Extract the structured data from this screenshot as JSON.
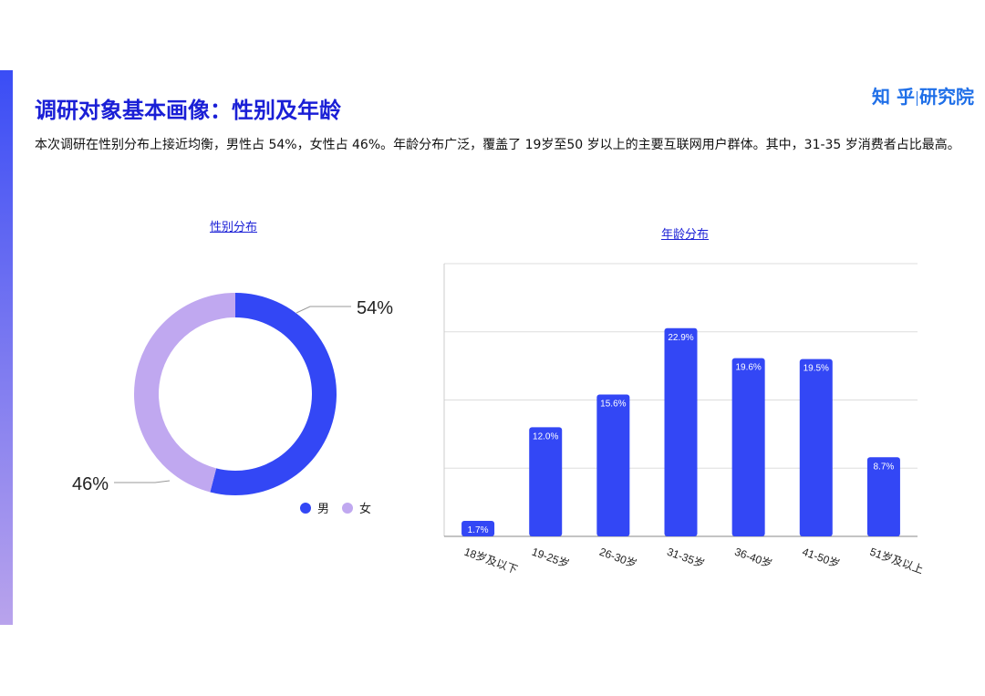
{
  "header": {
    "title": "调研对象基本画像：性别及年龄",
    "logo_left": "知 乎",
    "logo_right": "研究院",
    "description": "本次调研在性别分布上接近均衡，男性占 54%，女性占 46%。年龄分布广泛，覆盖了 19岁至50 岁以上的主要互联网用户群体。其中，31-35 岁消费者占比最高。"
  },
  "colors": {
    "accent": "#3347f5",
    "secondary": "#c0a8f0",
    "title": "#1a1fd6"
  },
  "chart_data": [
    {
      "type": "pie",
      "title": "性别分布",
      "categories": [
        "男",
        "女"
      ],
      "values": [
        54,
        46
      ],
      "labels": [
        "54%",
        "46%"
      ],
      "colors": [
        "#3347f5",
        "#c0a8f0"
      ],
      "legend": "bottom-right"
    },
    {
      "type": "bar",
      "title": "年龄分布",
      "categories": [
        "18岁及以下",
        "19-25岁",
        "26-30岁",
        "31-35岁",
        "36-40岁",
        "41-50岁",
        "51岁及以上"
      ],
      "values": [
        1.7,
        12.0,
        15.6,
        22.9,
        19.6,
        19.5,
        8.7
      ],
      "labels": [
        "1.7%",
        "12.0%",
        "15.6%",
        "22.9%",
        "19.6%",
        "19.5%",
        "8.7%"
      ],
      "ylim": [
        0,
        30
      ],
      "grid": true,
      "color": "#3347f5"
    }
  ]
}
